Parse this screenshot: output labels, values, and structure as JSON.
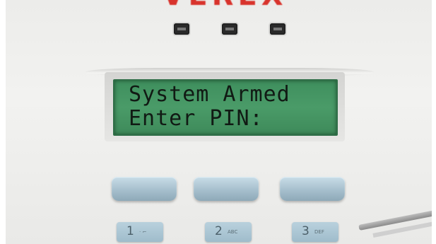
{
  "brand": {
    "text": "VEREX"
  },
  "indicators": [
    {
      "icon": "status-led-icon"
    },
    {
      "icon": "status-led-icon"
    },
    {
      "icon": "status-led-icon"
    }
  ],
  "display": {
    "line1": "System Armed",
    "line2": "Enter PIN:"
  },
  "function_keys": [
    {
      "label": ""
    },
    {
      "label": ""
    },
    {
      "label": ""
    }
  ],
  "keys": [
    {
      "number": "1",
      "letters": "· ⌐"
    },
    {
      "number": "2",
      "letters": "ABC"
    },
    {
      "number": "3",
      "letters": "DEF"
    }
  ],
  "colors": {
    "lcd": "#4a9b68",
    "brand": "#d8332c",
    "key": "#a6bfcd"
  }
}
